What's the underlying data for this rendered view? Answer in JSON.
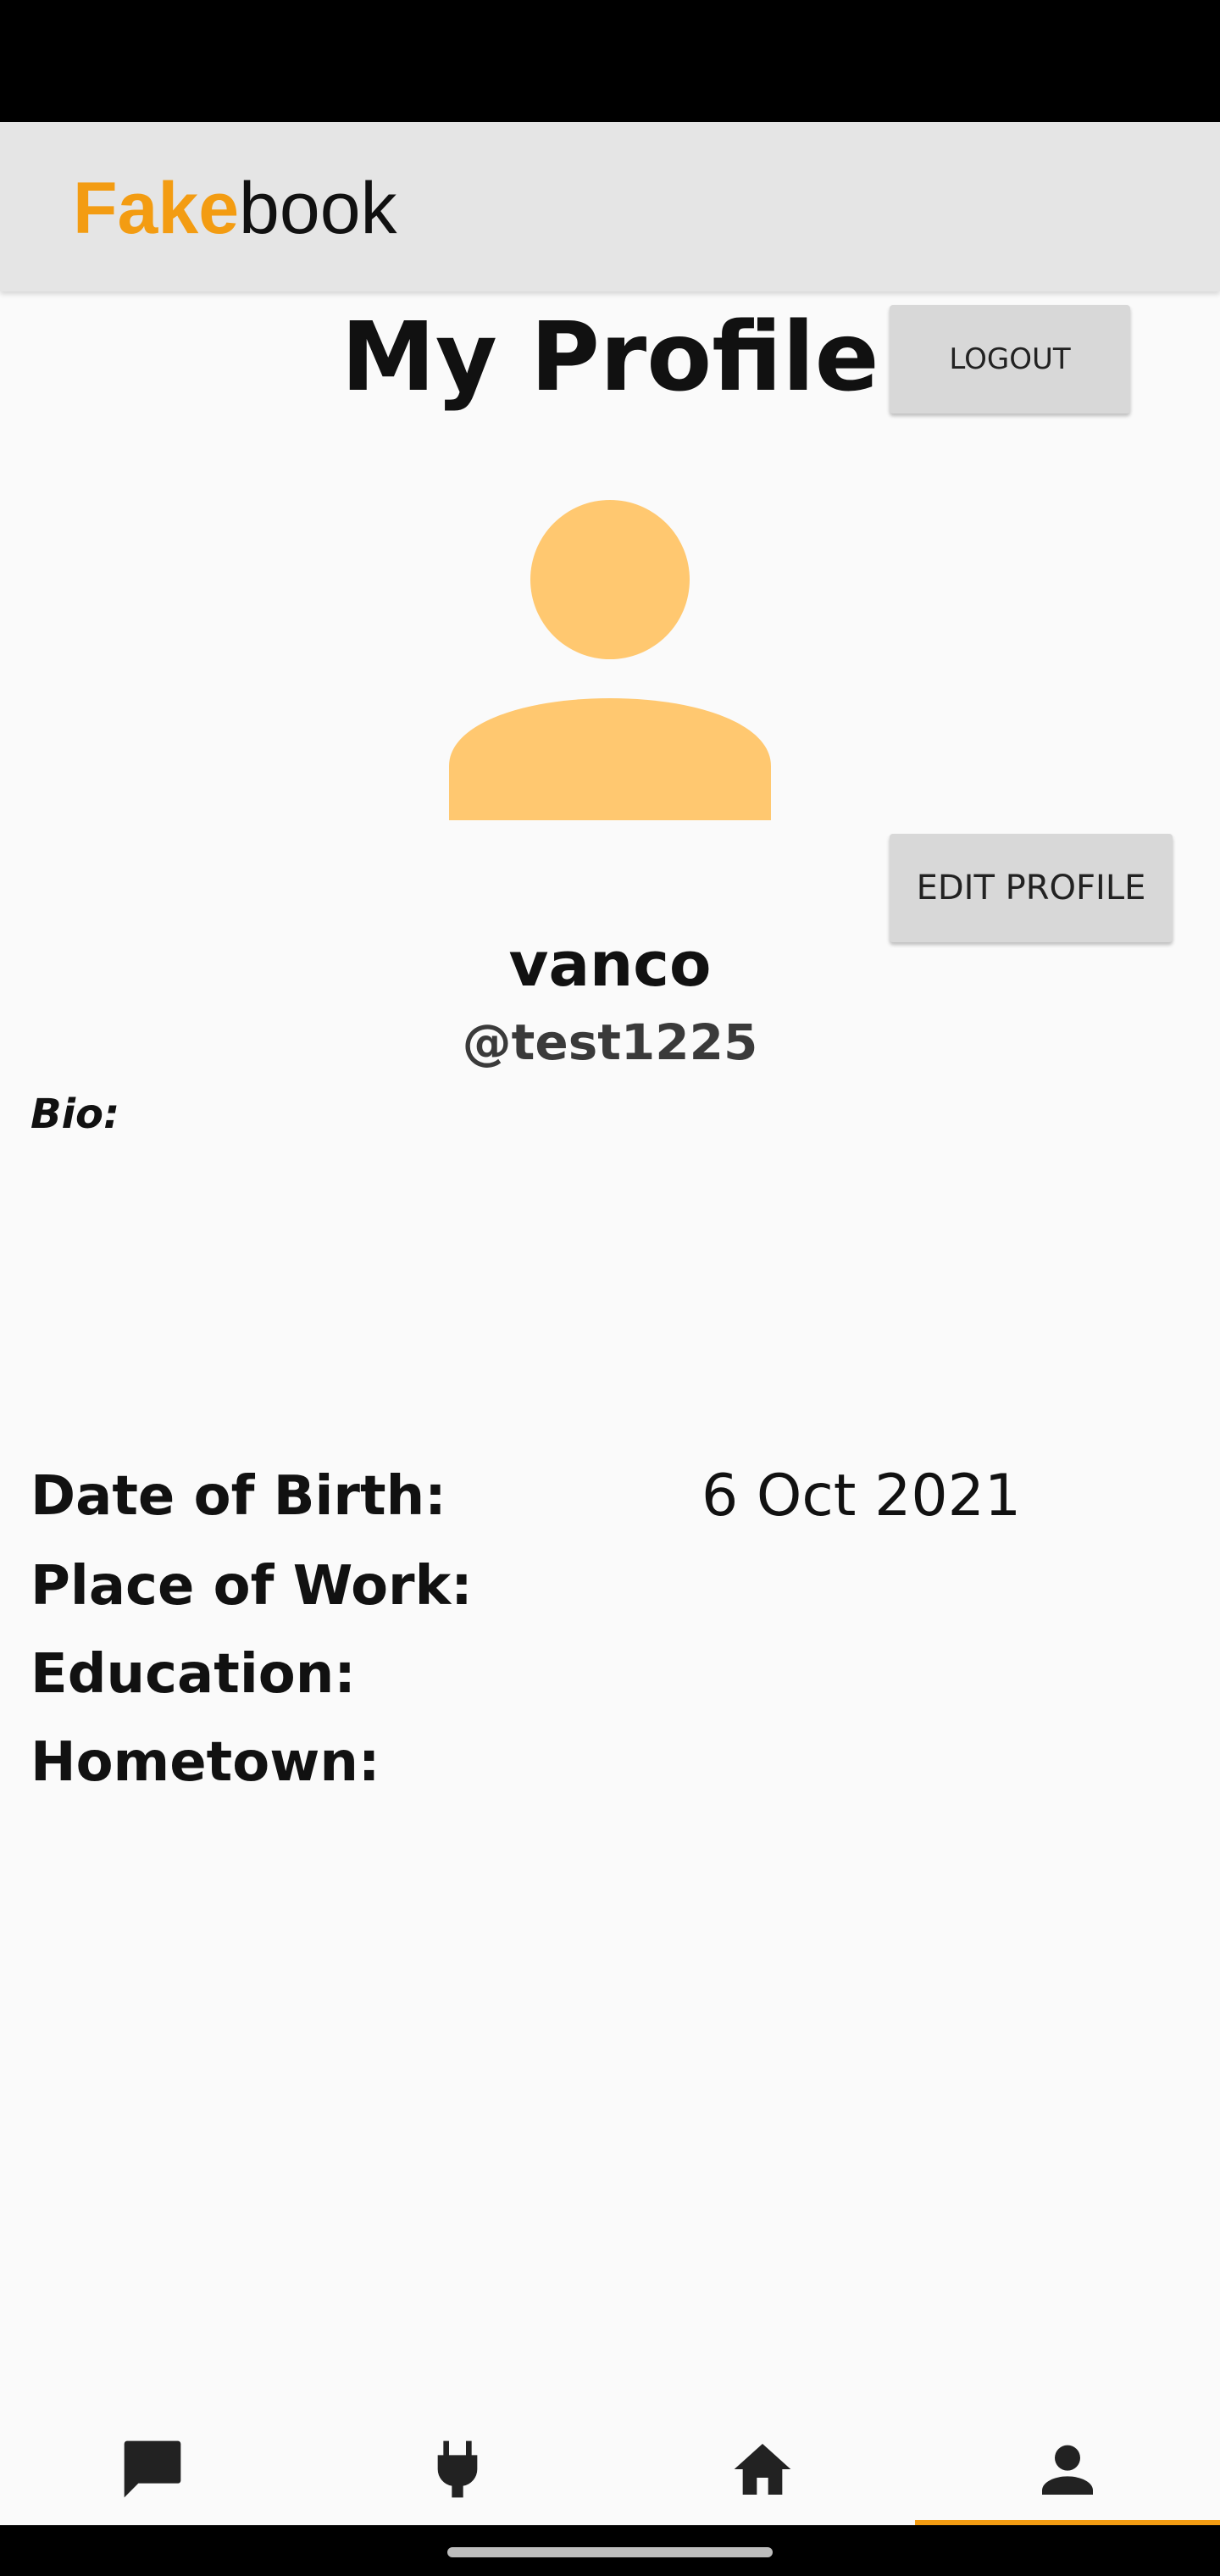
{
  "app_bar": {
    "logo_accent": "Fake",
    "logo_rest": "book",
    "accent_color": "#f39c12"
  },
  "profile": {
    "title": "My Profile",
    "logout_label": "LOGOUT",
    "edit_label": "EDIT PROFILE",
    "display_name": "vanco",
    "handle": "@test1225",
    "bio_label": "Bio:",
    "avatar_icon": "person-avatar-icon",
    "avatar_color": "#ffc870"
  },
  "details": [
    {
      "label": "Date of Birth:",
      "value": "6 Oct 2021"
    },
    {
      "label": "Place of Work:",
      "value": ""
    },
    {
      "label": "Education:",
      "value": ""
    },
    {
      "label": "Hometown:",
      "value": ""
    }
  ],
  "bottom_nav": {
    "items": [
      {
        "icon": "chat-icon"
      },
      {
        "icon": "plug-icon"
      },
      {
        "icon": "home-icon"
      },
      {
        "icon": "person-icon",
        "active": true
      }
    ]
  }
}
